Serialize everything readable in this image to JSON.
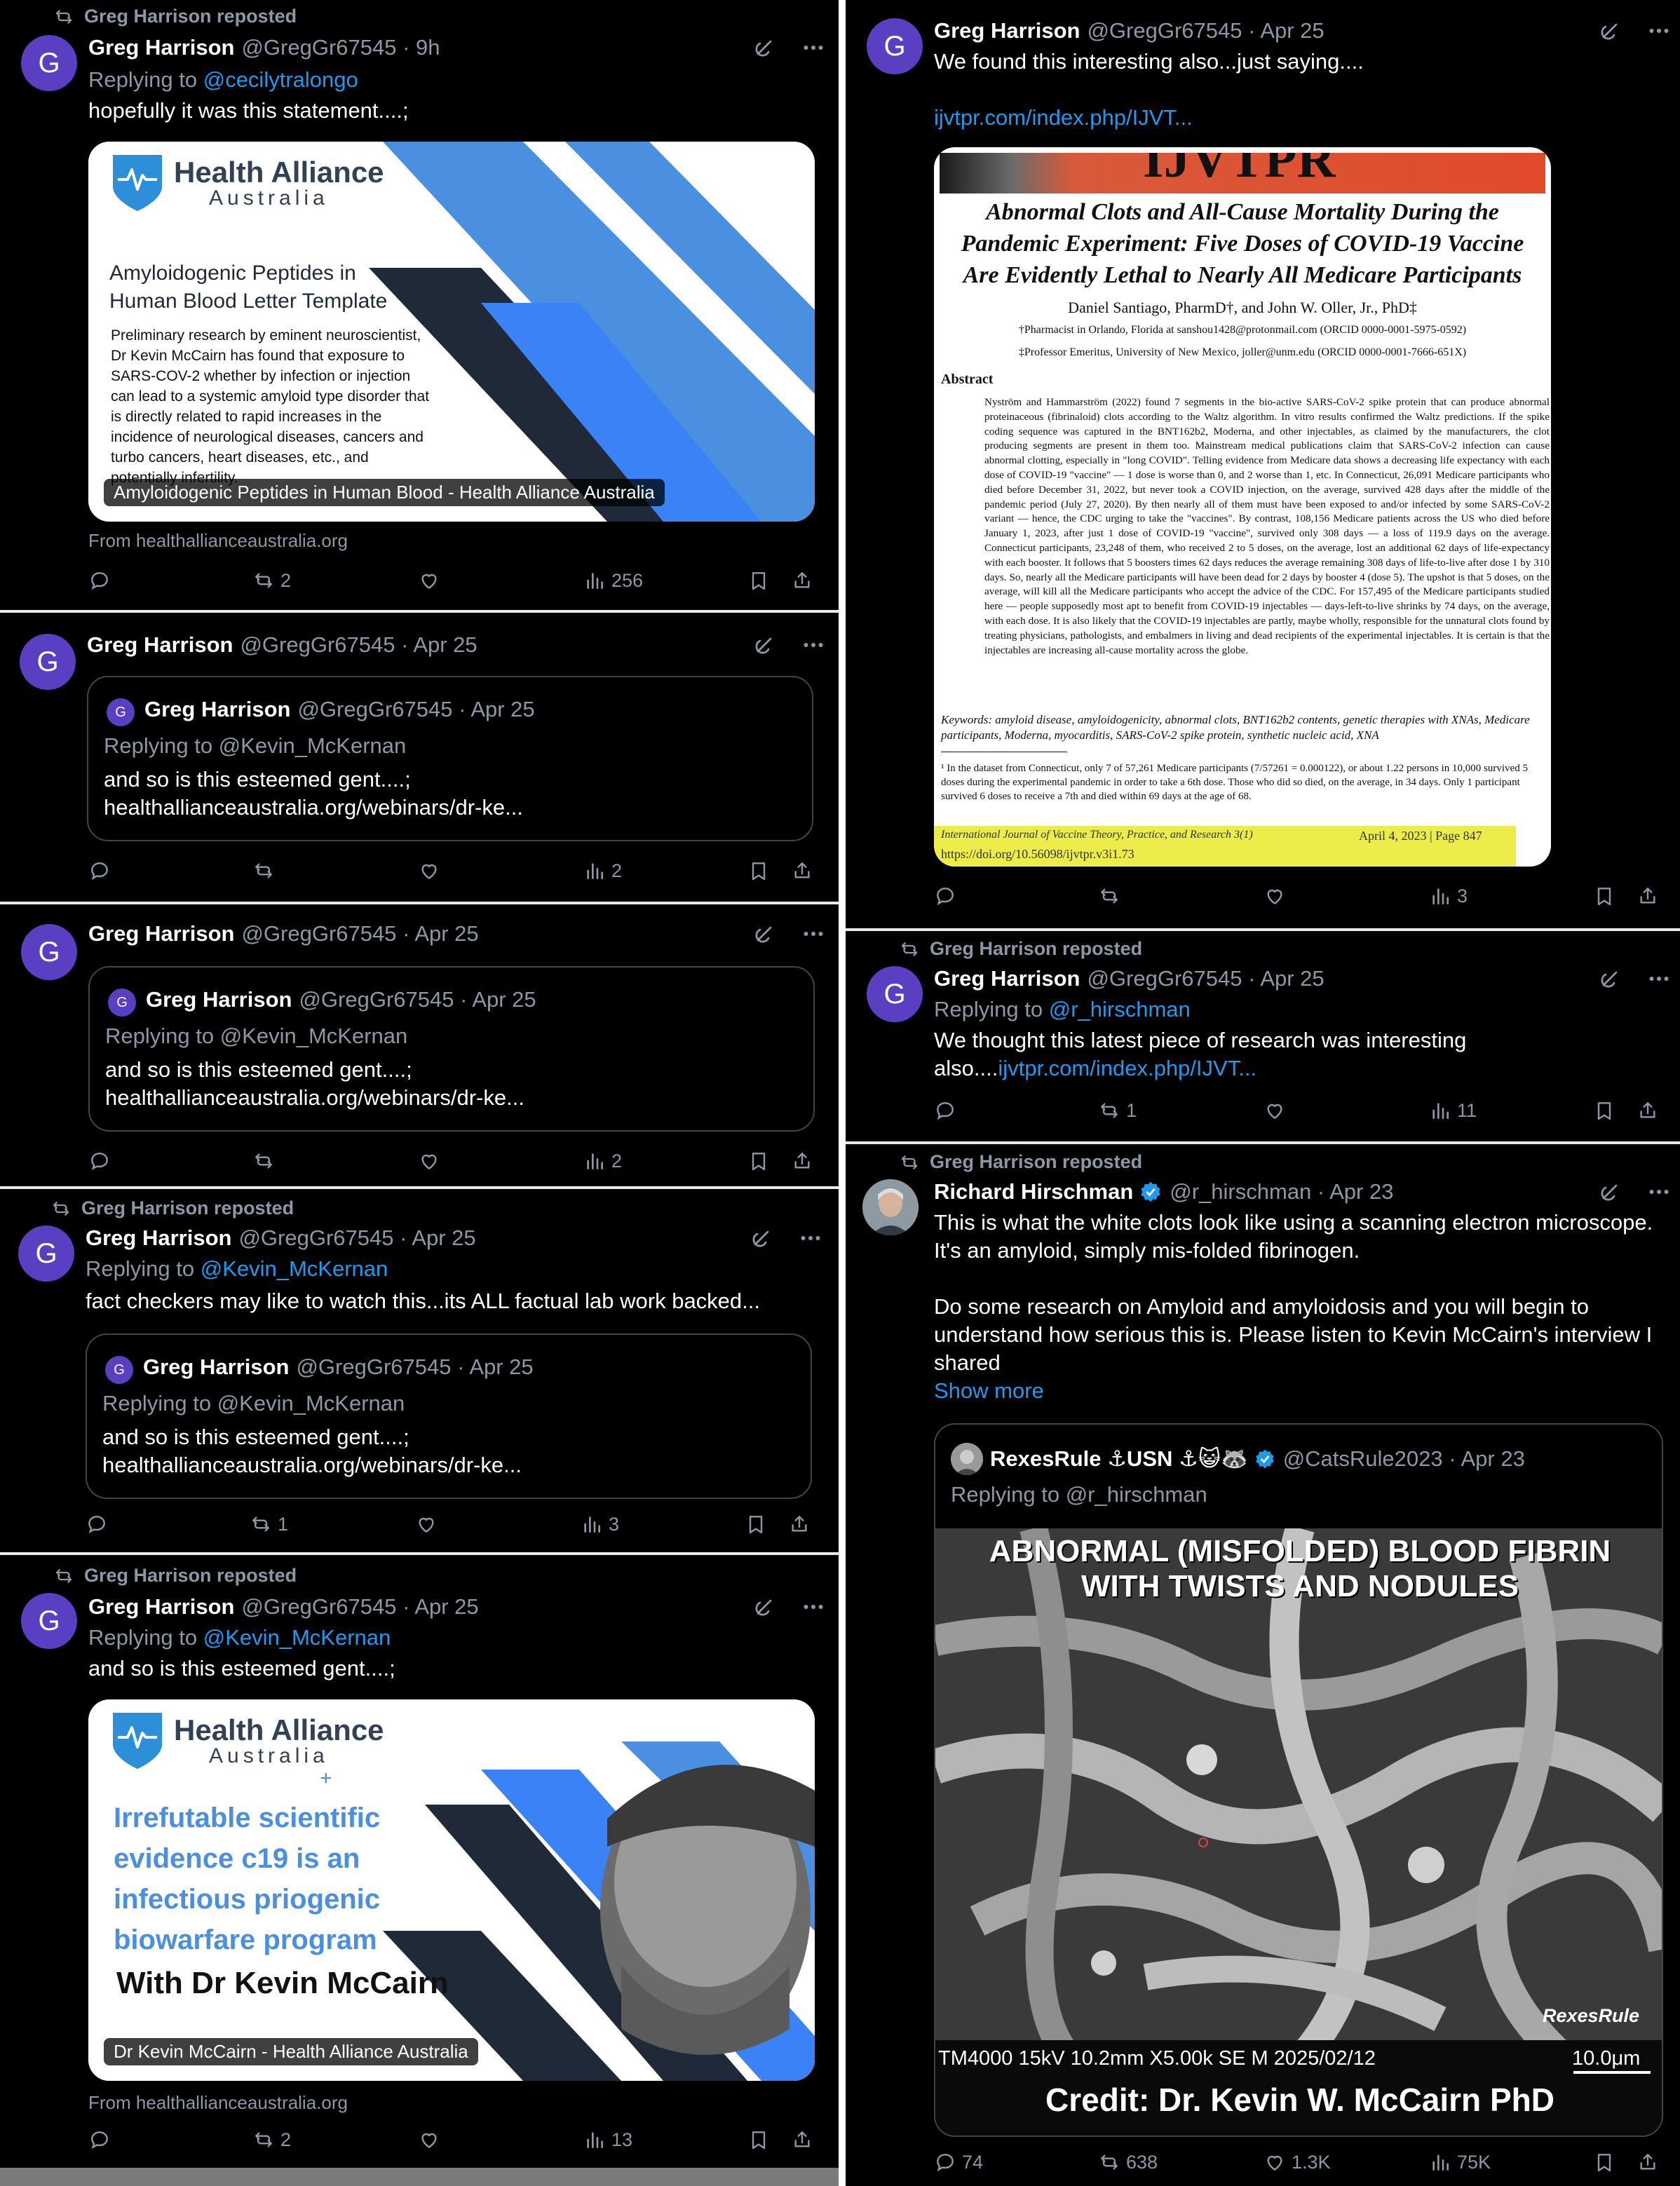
{
  "colors": {
    "accent": "#1d9bf0",
    "avatar": "#5b3fc2",
    "muted": "#8b98a5",
    "verified": "#1d9bf0"
  },
  "left_tweets": [
    {
      "repost_label": "Greg Harrison reposted",
      "avatar_letter": "G",
      "name": "Greg Harrison",
      "handle_time": "@GregGr67545 · 9h",
      "replying_prefix": "Replying to ",
      "replying_to": "@cecilytralongo",
      "text": "hopefully it was this statement....;",
      "card": {
        "logo_title": "Health Alliance",
        "logo_subtitle": "Australia",
        "heading": "Amyloidogenic Peptides in Human Blood Letter Template",
        "body": "Preliminary research by eminent neuroscientist, Dr Kevin McCairn has found that exposure to SARS-COV-2 whether by infection or injection can lead to a systemic amyloid type disorder that is directly related to rapid increases in the incidence of neurological diseases, cancers and turbo cancers, heart diseases, etc., and potentially infertility.",
        "label": "Amyloidogenic Peptides in Human Blood - Health Alliance Australia"
      },
      "from": "From healthallianceaustralia.org",
      "counts": {
        "reply": "",
        "repost": "2",
        "like": "",
        "views": "256"
      }
    },
    {
      "avatar_letter": "G",
      "name": "Greg Harrison",
      "handle_time": "@GregGr67545 · Apr 25",
      "quote": {
        "avatar_letter": "G",
        "name": "Greg Harrison",
        "handle_time": "@GregGr67545 · Apr 25",
        "replying": "Replying to @Kevin_McKernan",
        "text1": "and so is this esteemed gent....;",
        "text2": "healthallianceaustralia.org/webinars/dr-ke..."
      },
      "counts": {
        "reply": "",
        "repost": "",
        "like": "",
        "views": "2"
      }
    },
    {
      "avatar_letter": "G",
      "name": "Greg Harrison",
      "handle_time": "@GregGr67545 · Apr 25",
      "quote": {
        "avatar_letter": "G",
        "name": "Greg Harrison",
        "handle_time": "@GregGr67545 · Apr 25",
        "replying": "Replying to @Kevin_McKernan",
        "text1": "and so is this esteemed gent....;",
        "text2": "healthallianceaustralia.org/webinars/dr-ke..."
      },
      "counts": {
        "reply": "",
        "repost": "",
        "like": "",
        "views": "2"
      }
    },
    {
      "repost_label": "Greg Harrison reposted",
      "avatar_letter": "G",
      "name": "Greg Harrison",
      "handle_time": "@GregGr67545 · Apr 25",
      "replying_prefix": "Replying to ",
      "replying_to": "@Kevin_McKernan",
      "text": "fact checkers may like to watch this...its ALL factual lab work backed...",
      "quote": {
        "avatar_letter": "G",
        "name": "Greg Harrison",
        "handle_time": "@GregGr67545 · Apr 25",
        "replying": "Replying to @Kevin_McKernan",
        "text1": "and so is this esteemed gent....;",
        "text2": "healthallianceaustralia.org/webinars/dr-ke..."
      },
      "counts": {
        "reply": "",
        "repost": "1",
        "like": "",
        "views": "3"
      }
    },
    {
      "repost_label": "Greg Harrison reposted",
      "avatar_letter": "G",
      "name": "Greg Harrison",
      "handle_time": "@GregGr67545 · Apr 25",
      "replying_prefix": "Replying to ",
      "replying_to": "@Kevin_McKernan",
      "text": "and so is this esteemed gent....;",
      "card": {
        "logo_title": "Health Alliance",
        "logo_subtitle": "Australia",
        "plus": "+",
        "headline1": "Irrefutable scientific",
        "headline2": "evidence c19 is an",
        "headline3": "infectious priogenic",
        "headline4": "biowarfare program",
        "with": "With Dr Kevin McCairn",
        "label": "Dr Kevin McCairn - Health Alliance Australia"
      },
      "from": "From healthallianceaustralia.org",
      "counts": {
        "reply": "",
        "repost": "2",
        "like": "",
        "views": "13"
      }
    }
  ],
  "right_tweets": [
    {
      "avatar_letter": "G",
      "name": "Greg Harrison",
      "handle_time": "@GregGr67545 · Apr 25",
      "text": "We found this interesting also...just saying....",
      "link": "ijvtpr.com/index.php/IJVT...",
      "paper": {
        "journal_banner": "IJVTPR",
        "title": "Abnormal Clots and All-Cause Mortality During the Pandemic Experiment: Five Doses of COVID-19 Vaccine Are Evidently Lethal to Nearly All Medicare Participants",
        "authors": "Daniel Santiago, PharmD†, and John W. Oller, Jr., PhD‡",
        "aff1": "†Pharmacist in Orlando, Florida at sanshou1428@protonmail.com (ORCID 0000-0001-5975-0592)",
        "aff2": "‡Professor Emeritus, University of New Mexico, joller@unm.edu (ORCID 0000-0001-7666-651X)",
        "abstract_heading": "Abstract",
        "abstract": "Nyström and Hammarström (2022) found 7 segments in the bio-active SARS-CoV-2 spike protein that can produce abnormal proteinaceous (fibrinaloid) clots according to the Waltz algorithm. In vitro results confirmed the Waltz predictions. If the spike coding sequence was captured in the BNT162b2, Moderna, and other injectables, as claimed by the manufacturers, the clot producing segments are present in them too. Mainstream medical publications claim that SARS-CoV-2 infection can cause abnormal clotting, especially in \"long COVID\". Telling evidence from Medicare data shows a decreasing life expectancy with each dose of COVID-19 \"vaccine\" — 1 dose is worse than 0, and 2 worse than 1, etc. In Connecticut, 26,091 Medicare participants who died before December 31, 2022, but never took a COVID injection, on the average, survived 428 days after the middle of the pandemic period (July 27, 2020). By then nearly all of them must have been exposed to and/or infected by some SARS-CoV-2 variant — hence, the CDC urging to take the \"vaccines\". By contrast, 108,156 Medicare patients across the US who died before January 1, 2023, after just 1 dose of COVID-19 \"vaccine\", survived only 308 days — a loss of 119.9 days on the average. Connecticut participants, 23,248 of them, who received 2 to 5 doses, on the average, lost an additional 62 days of life-expectancy with each booster. It follows that 5 boosters times 62 days reduces the average remaining 308 days of life-to-live after dose 1 by 310 days. So, nearly all the Medicare participants will have been dead for 2 days by booster 4 (dose 5). The upshot is that 5 doses, on the average, will kill all the Medicare participants who accept the advice of the CDC. For 157,495 of the Medicare participants studied here — people supposedly most apt to benefit from COVID-19 injectables — days-left-to-live shrinks by 74 days, on the average, with each dose. It is also likely that the COVID-19 injectables are partly, maybe wholly, responsible for the unnatural clots found by treating physicians, pathologists, and embalmers in living and dead recipients of the experimental injectables. It is certain is that the injectables are increasing all-cause mortality across the globe.",
        "keywords": "Keywords: amyloid disease, amyloidogenicity, abnormal clots, BNT162b2 contents, genetic therapies with XNAs, Medicare participants, Moderna, myocarditis, SARS-CoV-2 spike protein, synthetic nucleic acid, XNA",
        "footnote": "¹ In the dataset from Connecticut, only 7 of 57,261 Medicare participants (7/57261 = 0.000122), or about 1.22 persons in 10,000 survived 5 doses during the experimental pandemic in order to take a 6th dose. Those who did so died, on the average, in 34 days. Only 1 participant survived 6 doses to receive a 7th and died within 69 days at the age of 68.",
        "footer_left": "International Journal of Vaccine Theory, Practice, and Research 3(1)",
        "footer_right": "April 4, 2023 | Page 847",
        "doi": "https://doi.org/10.56098/ijvtpr.v3i1.73"
      },
      "counts": {
        "reply": "",
        "repost": "",
        "like": "",
        "views": "3"
      }
    },
    {
      "repost_label": "Greg Harrison reposted",
      "avatar_letter": "G",
      "name": "Greg Harrison",
      "handle_time": "@GregGr67545 · Apr 25",
      "replying_prefix": "Replying to ",
      "replying_to": "@r_hirschman",
      "text1": "We thought this latest piece of research was interesting",
      "text2_prefix": "also....",
      "text2_link": "ijvtpr.com/index.php/IJVT...",
      "counts": {
        "reply": "",
        "repost": "1",
        "like": "",
        "views": "11"
      }
    },
    {
      "repost_label": "Greg Harrison reposted",
      "name": "Richard Hirschman",
      "handle_time": "@r_hirschman · Apr 23",
      "text1": "This is what the white clots look like using a scanning electron microscope.",
      "text2": "It's an amyloid, simply mis-folded fibrinogen.",
      "text3": "Do some research on Amyloid and amyloidosis and you will begin to",
      "text4": "understand how serious this is. Please listen to Kevin McCairn's interview I",
      "text5": "shared",
      "show_more": "Show more",
      "quote": {
        "name": "RexesRule ⚓USN ⚓😺🦝",
        "handle_time": "@CatsRule2023 · Apr 23",
        "replying": "Replying to @r_hirschman",
        "image_title1": "ABNORMAL (MISFOLDED) BLOOD FIBRIN",
        "image_title2": "WITH TWISTS AND NODULES",
        "watermark": "RexesRule",
        "sem_info": "TM4000 15kV 10.2mm X5.00k SE M 2025/02/12",
        "scale": "10.0μm",
        "credit": "Credit:  Dr. Kevin W. McCairn PhD"
      },
      "counts": {
        "reply": "74",
        "repost": "638",
        "like": "1.3K",
        "views": "75K"
      }
    }
  ]
}
